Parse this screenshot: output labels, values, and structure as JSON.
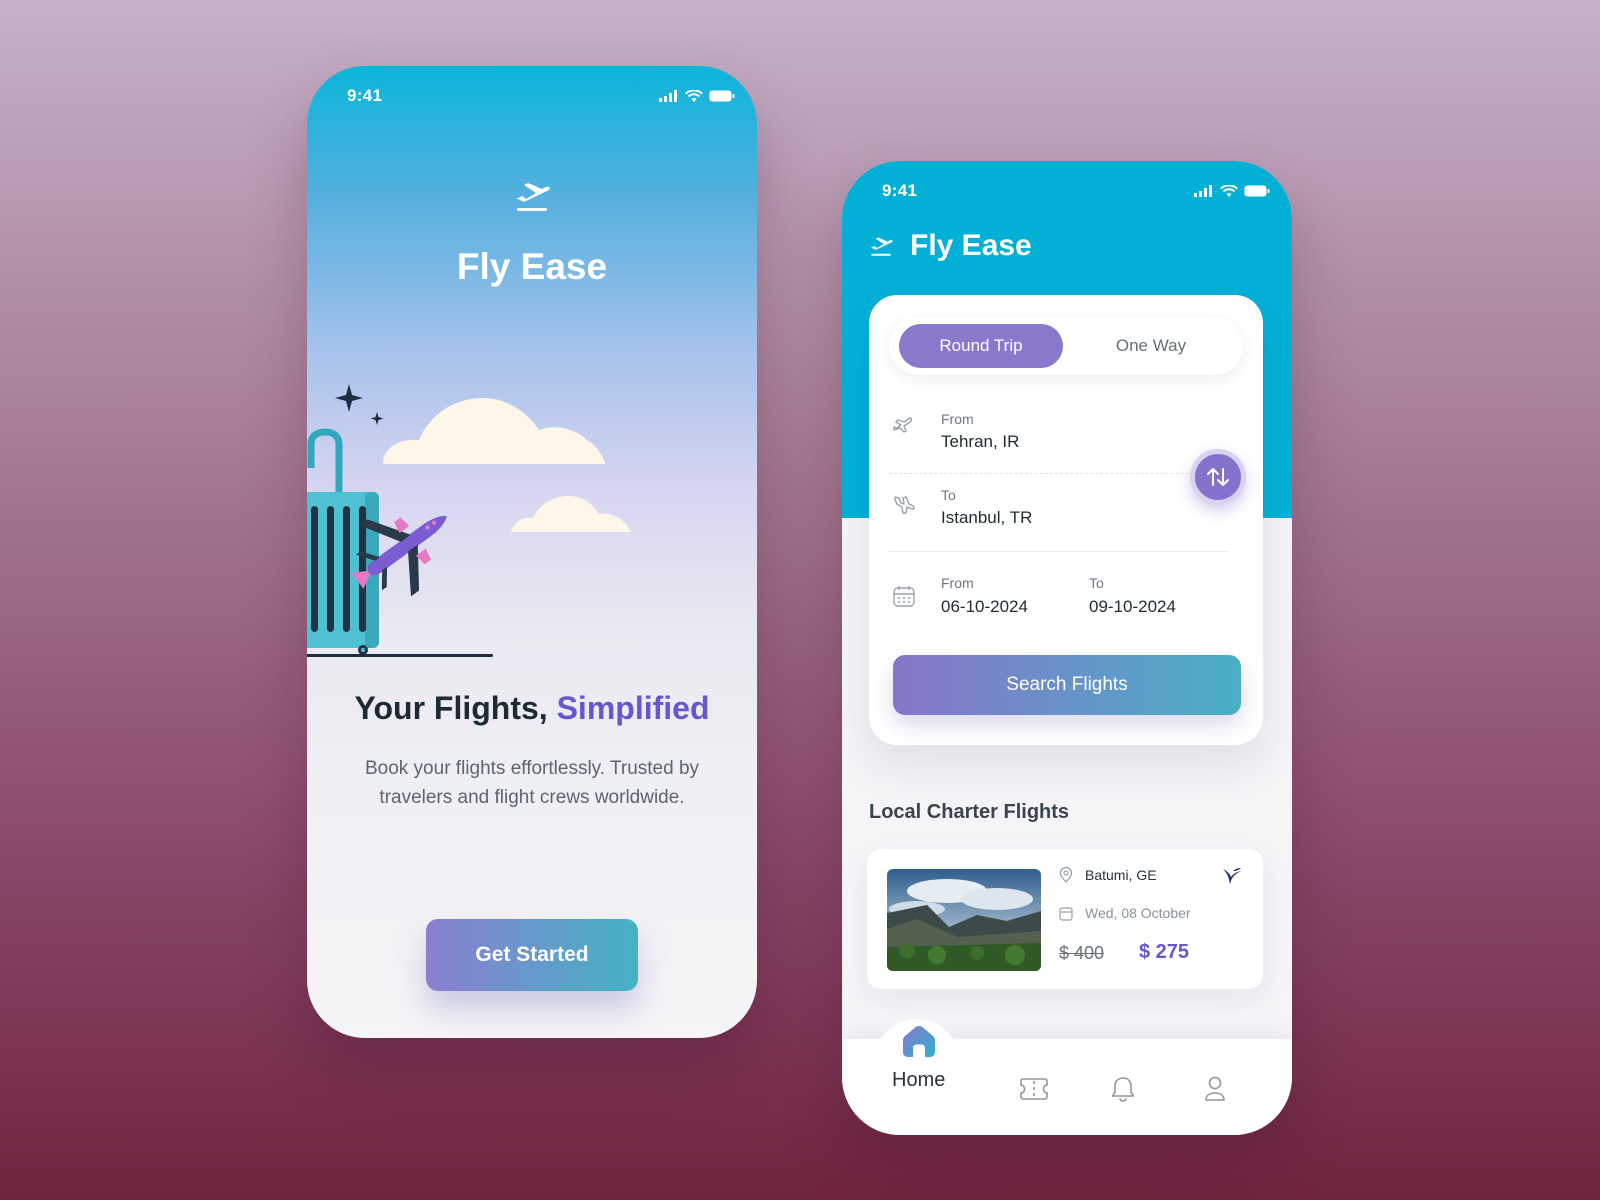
{
  "welcome_screen": {
    "status": {
      "time": "9:41"
    },
    "brand": {
      "name": "Fly Ease",
      "logo_icon": "plane-takeoff-icon"
    },
    "headline": {
      "part1": "Your Flights, ",
      "accent": "Simplified"
    },
    "subtext": "Book your flights effortlessly. Trusted by travelers and flight crews worldwide.",
    "cta_label": "Get Started"
  },
  "search_screen": {
    "status": {
      "time": "9:41"
    },
    "header": {
      "title": "Fly Ease",
      "logo_icon": "plane-takeoff-icon"
    },
    "trip_types": {
      "selected": "Round Trip",
      "other": "One Way"
    },
    "origin": {
      "label": "From",
      "value": "Tehran, IR"
    },
    "destination": {
      "label": "To",
      "value": "Istanbul, TR"
    },
    "dates": {
      "from_label": "From",
      "from_value": "06-10-2024",
      "to_label": "To",
      "to_value": "09-10-2024"
    },
    "search_label": "Search Flights",
    "section_title": "Local Charter Flights",
    "charter": {
      "location": "Batumi, GE",
      "date": "Wed, 08 October",
      "old_price": "$ 400",
      "price": "$ 275"
    },
    "nav": {
      "home_label": "Home",
      "items": [
        "home-icon",
        "ticket-icon",
        "bell-icon",
        "user-icon"
      ]
    }
  },
  "colors": {
    "accent_purple": "#6a54cf",
    "header_cyan": "#02b0d6",
    "button_gradient_start": "#8775ca",
    "button_gradient_end": "#49afc4"
  }
}
